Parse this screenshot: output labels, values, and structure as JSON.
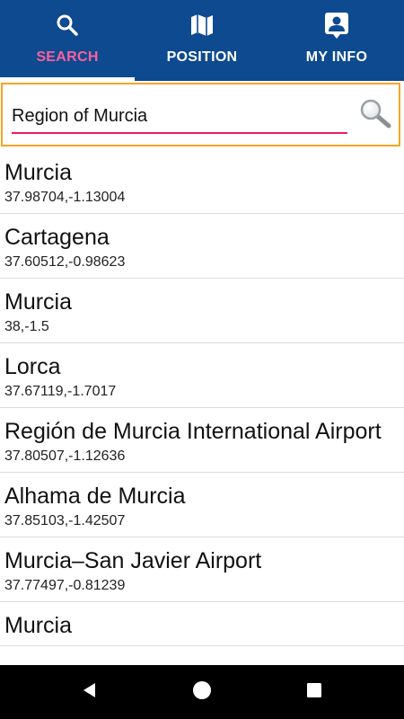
{
  "tabs": [
    {
      "label": "SEARCH",
      "icon": "search-icon",
      "active": true
    },
    {
      "label": "POSITION",
      "icon": "map-icon",
      "active": false
    },
    {
      "label": "MY INFO",
      "icon": "contact-icon",
      "active": false
    }
  ],
  "search": {
    "value": "Region of Murcia"
  },
  "results": [
    {
      "name": "Murcia",
      "coords": "37.98704,-1.13004"
    },
    {
      "name": "Cartagena",
      "coords": "37.60512,-0.98623"
    },
    {
      "name": "Murcia",
      "coords": "38,-1.5"
    },
    {
      "name": "Lorca",
      "coords": "37.67119,-1.7017"
    },
    {
      "name": "Región de Murcia International Airport",
      "coords": "37.80507,-1.12636"
    },
    {
      "name": "Alhama de Murcia",
      "coords": "37.85103,-1.42507"
    },
    {
      "name": "Murcia–San Javier Airport",
      "coords": "37.77497,-0.81239"
    },
    {
      "name": "Murcia",
      "coords": ""
    }
  ],
  "colors": {
    "appbar": "#0d4a8f",
    "active_tab_text": "#ff5f9e",
    "search_border": "#f5a623",
    "input_underline": "#e91e63"
  }
}
